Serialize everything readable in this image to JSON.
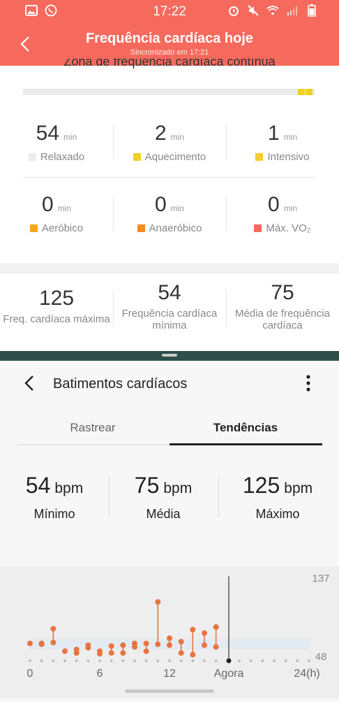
{
  "status_bar": {
    "time": "17:22"
  },
  "header": {
    "title": "Frequência cardíaca hoje",
    "subtitle": "Sincronizado em 17:21"
  },
  "zone": {
    "title": "Zona de frequência cardíaca contínua",
    "unit": "min",
    "items": [
      {
        "value": "54",
        "label": "Relaxado",
        "color": "#ebebeb"
      },
      {
        "value": "2",
        "label": "Aquecimento",
        "color": "#f3cf2a"
      },
      {
        "value": "1",
        "label": "Intensivo",
        "color": "#f3cf2a"
      },
      {
        "value": "0",
        "label": "Aeróbico",
        "color": "#f5a623"
      },
      {
        "value": "0",
        "label": "Anaeróbico",
        "color": "#f28c22"
      },
      {
        "value": "0",
        "label": "Máx. VO₂",
        "color": "#f56a5d"
      }
    ]
  },
  "stats": [
    {
      "value": "125",
      "label": "Freq. cardíaca máxima"
    },
    {
      "value": "54",
      "label": "Frequência cardíaca mínima"
    },
    {
      "value": "75",
      "label": "Média de frequência cardíaca"
    }
  ],
  "lower": {
    "title": "Batimentos cardíacos",
    "tabs": [
      "Rastrear",
      "Tendências"
    ],
    "active_tab": "Tendências",
    "summary": [
      {
        "value": "54",
        "unit": "bpm",
        "label": "Mínimo"
      },
      {
        "value": "75",
        "unit": "bpm",
        "label": "Média"
      },
      {
        "value": "125",
        "unit": "bpm",
        "label": "Máximo"
      }
    ]
  },
  "chart_data": {
    "type": "scatter",
    "title": "",
    "xlabel": "",
    "ylabel": "",
    "y_ticks": [
      "137",
      "48"
    ],
    "ylim": [
      48,
      137
    ],
    "xlim": [
      0,
      24
    ],
    "x_ticks": [
      "0",
      "6",
      "12",
      "Agora",
      "24(h)"
    ],
    "now_x": 17.1,
    "series_color": "#e8743f",
    "band": [
      57,
      69
    ],
    "ranges": [
      {
        "x": 0,
        "low": 64,
        "high": 64
      },
      {
        "x": 1,
        "low": 63,
        "high": 64
      },
      {
        "x": 2,
        "low": 65,
        "high": 81
      },
      {
        "x": 3,
        "low": 55,
        "high": 55
      },
      {
        "x": 4,
        "low": 53,
        "high": 57
      },
      {
        "x": 5,
        "low": 59,
        "high": 62
      },
      {
        "x": 6,
        "low": 52,
        "high": 55
      },
      {
        "x": 7,
        "low": 53,
        "high": 61
      },
      {
        "x": 8,
        "low": 53,
        "high": 62
      },
      {
        "x": 9,
        "low": 60,
        "high": 64
      },
      {
        "x": 10,
        "low": 55,
        "high": 64
      },
      {
        "x": 11,
        "low": 63,
        "high": 112
      },
      {
        "x": 12,
        "low": 62,
        "high": 70
      },
      {
        "x": 13,
        "low": 53,
        "high": 66
      },
      {
        "x": 14,
        "low": 51,
        "high": 80
      },
      {
        "x": 15,
        "low": 62,
        "high": 76
      },
      {
        "x": 16,
        "low": 60,
        "high": 83
      }
    ]
  }
}
